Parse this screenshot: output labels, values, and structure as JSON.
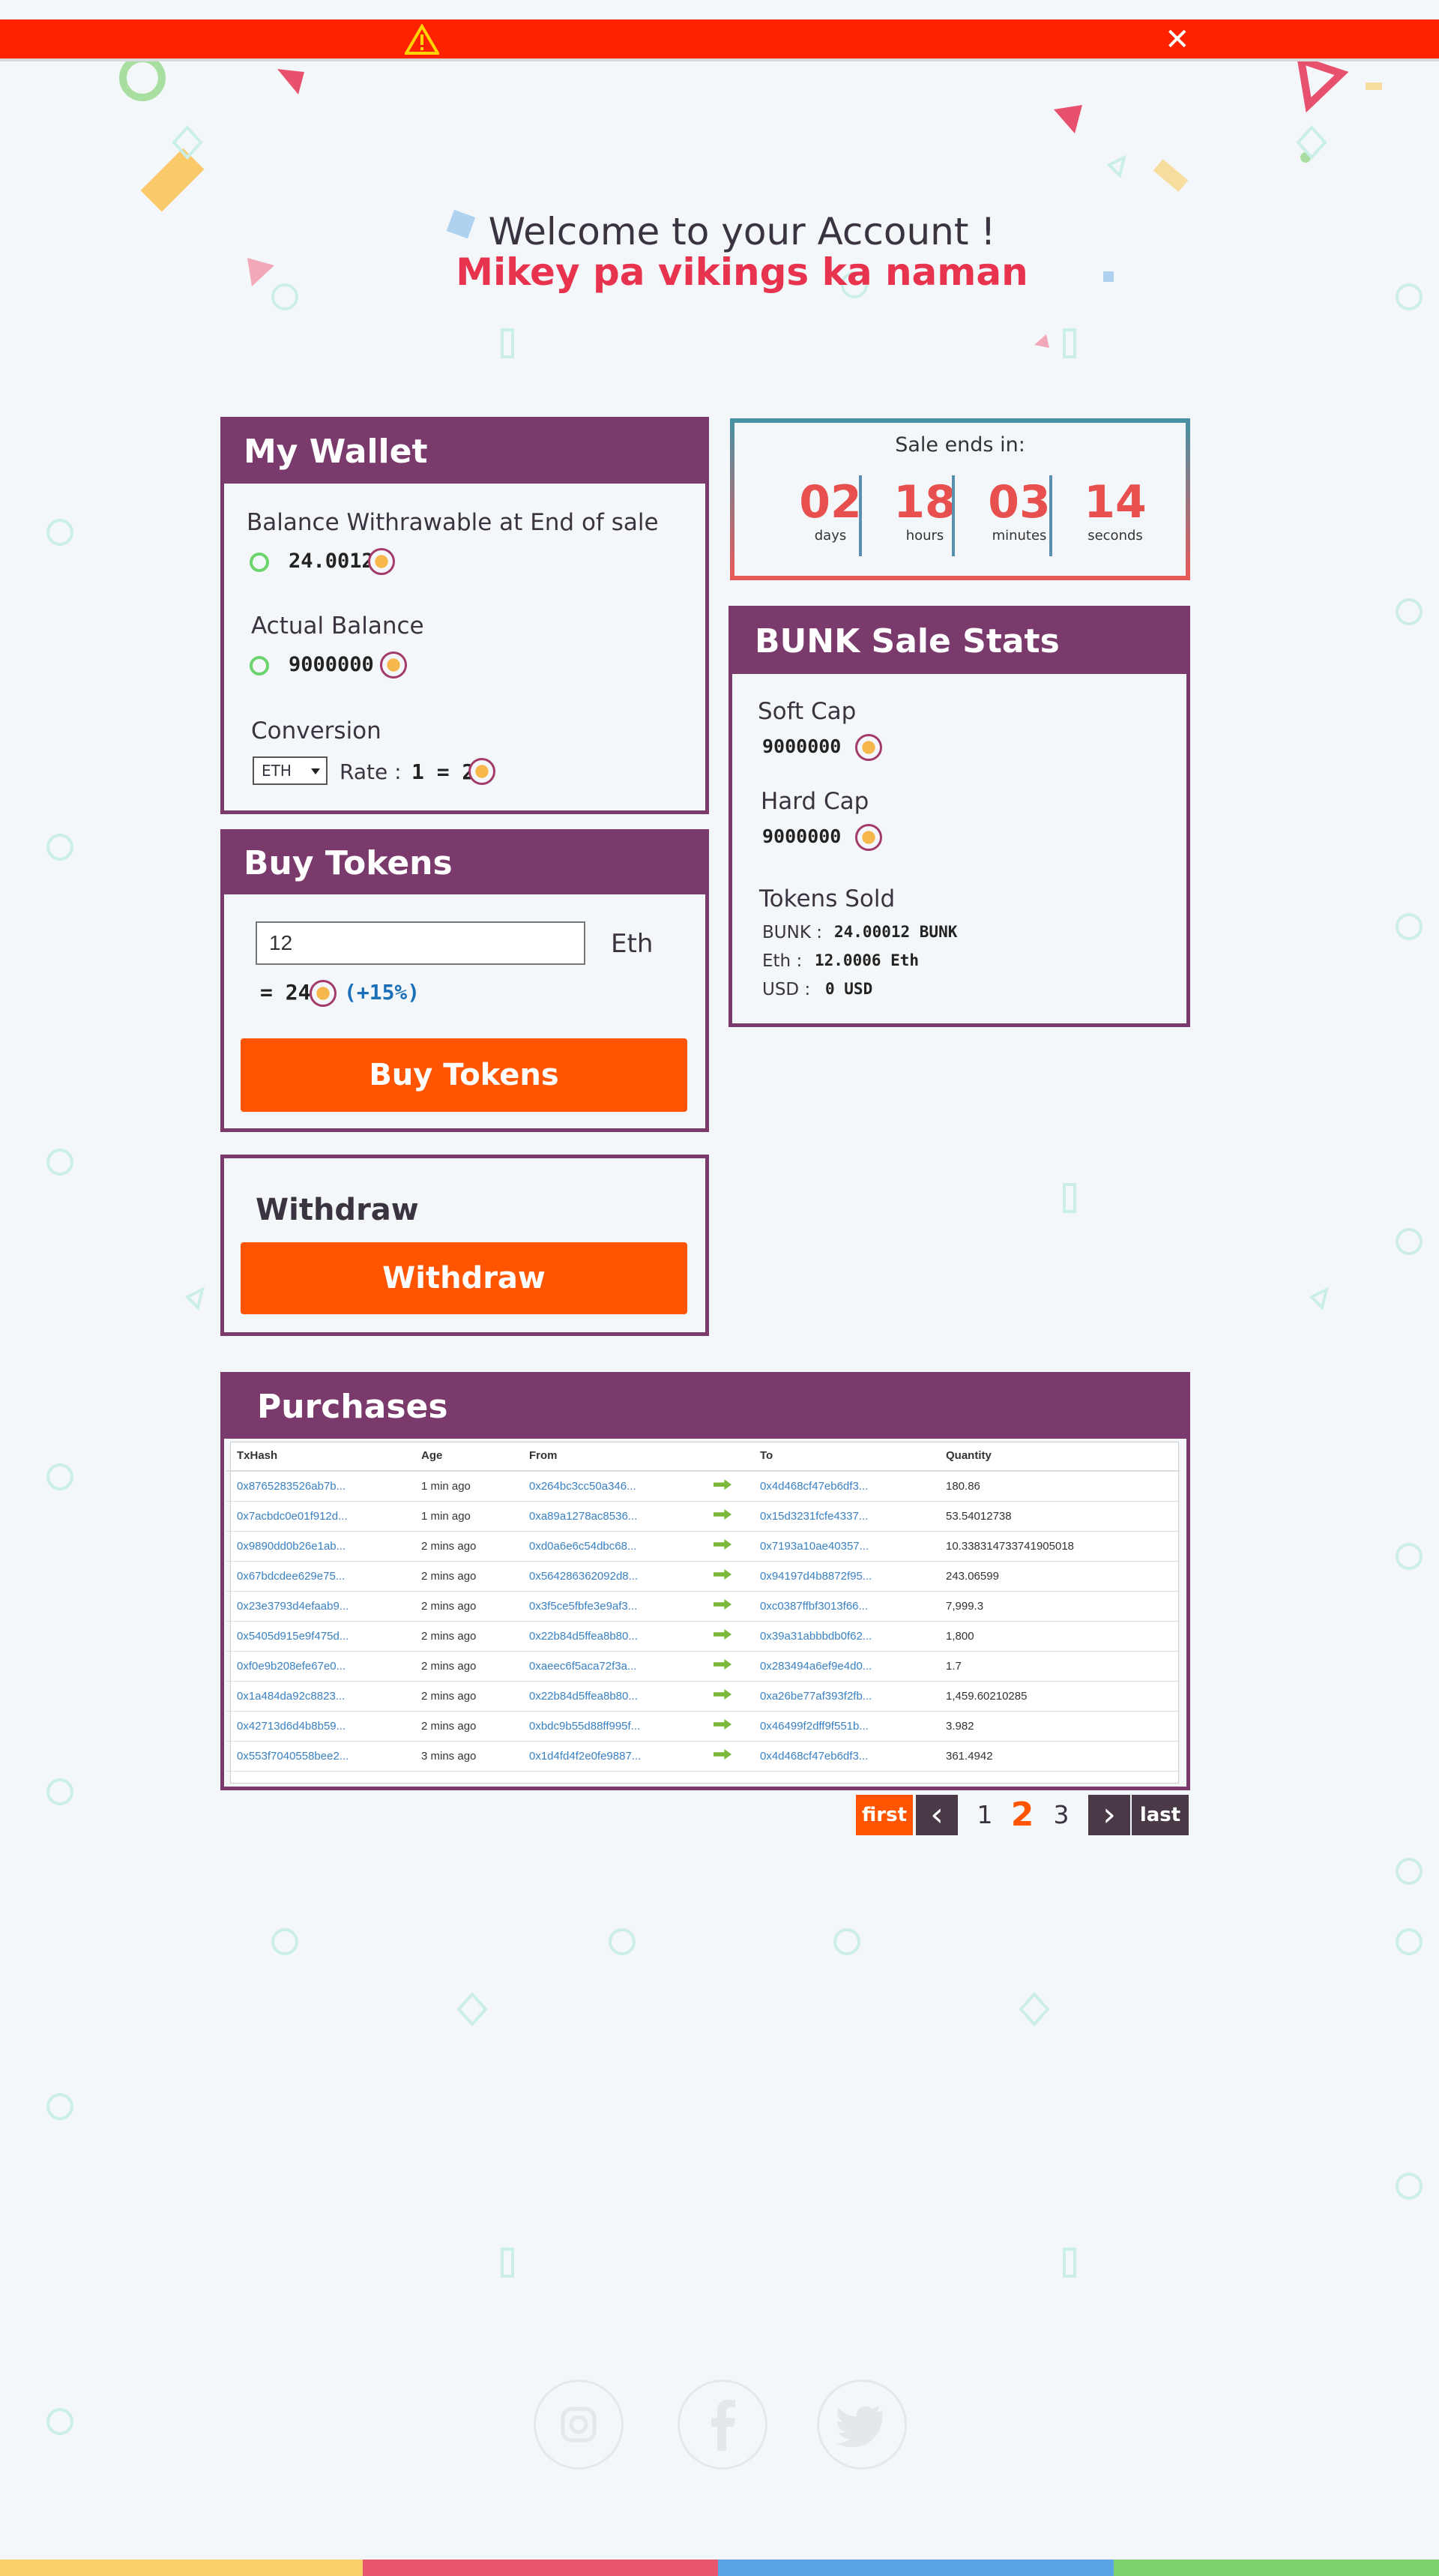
{
  "alert": {
    "close_label": "✕"
  },
  "welcome": {
    "title": "Welcome to your Account !",
    "name": "Mikey pa vikings ka naman"
  },
  "wallet": {
    "title": "My Wallet",
    "withdrawable_label": "Balance Withrawable at End of sale",
    "withdrawable_value": "24.0012",
    "actual_label": "Actual Balance",
    "actual_value": "9000000",
    "conversion_label": "Conversion",
    "currency_select": "ETH",
    "rate_label": "Rate :",
    "rate_value": "1 = 2"
  },
  "timer": {
    "title": "Sale ends in:",
    "days": "02",
    "days_label": "days",
    "hours": "18",
    "hours_label": "hours",
    "minutes": "03",
    "minutes_label": "minutes",
    "seconds": "14",
    "seconds_label": "seconds"
  },
  "stats": {
    "title": "BUNK Sale Stats",
    "soft_cap_label": "Soft Cap",
    "soft_cap_value": "9000000",
    "hard_cap_label": "Hard Cap",
    "hard_cap_value": "9000000",
    "tokens_sold_label": "Tokens Sold",
    "bunk_label": "BUNK :",
    "bunk_value": "24.00012 BUNK",
    "eth_label": "Eth :",
    "eth_value": "12.0006 Eth",
    "usd_label": "USD :",
    "usd_value": "0 USD"
  },
  "buy": {
    "title": "Buy Tokens",
    "amount_value": "12",
    "unit": "Eth",
    "result": "= 24",
    "bonus": "(+15%)",
    "button": "Buy Tokens"
  },
  "withdraw": {
    "title": "Withdraw",
    "button": "Withdraw"
  },
  "purchases": {
    "title": "Purchases",
    "columns": [
      "TxHash",
      "Age",
      "From",
      "",
      "To",
      "Quantity"
    ],
    "rows": [
      {
        "tx": "0x8765283526ab7b...",
        "age": "1 min ago",
        "from": "0x264bc3cc50a346...",
        "to": "0x4d468cf47eb6df3...",
        "qty": "180.86"
      },
      {
        "tx": "0x7acbdc0e01f912d...",
        "age": "1 min ago",
        "from": "0xa89a1278ac8536...",
        "to": "0x15d3231fcfe4337...",
        "qty": "53.54012738"
      },
      {
        "tx": "0x9890dd0b26e1ab...",
        "age": "2 mins ago",
        "from": "0xd0a6e6c54dbc68...",
        "to": "0x7193a10ae40357...",
        "qty": "10.338314733741905018"
      },
      {
        "tx": "0x67bdcdee629e75...",
        "age": "2 mins ago",
        "from": "0x564286362092d8...",
        "to": "0x94197d4b8872f95...",
        "qty": "243.06599"
      },
      {
        "tx": "0x23e3793d4efaab9...",
        "age": "2 mins ago",
        "from": "0x3f5ce5fbfe3e9af3...",
        "to": "0xc0387ffbf3013f66...",
        "qty": "7,999.3"
      },
      {
        "tx": "0x5405d915e9f475d...",
        "age": "2 mins ago",
        "from": "0x22b84d5ffea8b80...",
        "to": "0x39a31abbbdb0f62...",
        "qty": "1,800"
      },
      {
        "tx": "0xf0e9b208efe67e0...",
        "age": "2 mins ago",
        "from": "0xaeec6f5aca72f3a...",
        "to": "0x283494a6ef9e4d0...",
        "qty": "1.7"
      },
      {
        "tx": "0x1a484da92c8823...",
        "age": "2 mins ago",
        "from": "0x22b84d5ffea8b80...",
        "to": "0xa26be77af393f2fb...",
        "qty": "1,459.60210285"
      },
      {
        "tx": "0x42713d6d4b8b59...",
        "age": "2 mins ago",
        "from": "0xbdc9b55d88ff995f...",
        "to": "0x46499f2dff9f551b...",
        "qty": "3.982"
      },
      {
        "tx": "0x553f7040558bee2...",
        "age": "3 mins ago",
        "from": "0x1d4fd4f2e0fe9887...",
        "to": "0x4d468cf47eb6df3...",
        "qty": "361.4942"
      }
    ]
  },
  "pagination": {
    "first": "first",
    "p1": "1",
    "p2": "2",
    "p3": "3",
    "last": "last",
    "prev": "‹",
    "next": "›"
  },
  "colors": {
    "accent": "#7a3a6c",
    "button": "#ff5500",
    "alert": "#ff2200",
    "highlight": "#e8334e"
  }
}
